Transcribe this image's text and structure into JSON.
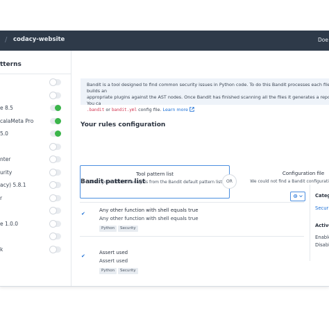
{
  "topbar": {
    "separator": "/",
    "project": "codacy-website",
    "caret": "⌄",
    "user": "Doe"
  },
  "sidebar": {
    "title": "tterns",
    "items": [
      {
        "label": "",
        "on": false
      },
      {
        "label": "",
        "on": false
      },
      {
        "label": "e 8.5",
        "on": true
      },
      {
        "label": "calaMeta Pro",
        "on": true
      },
      {
        "label": "5.0",
        "on": true
      },
      {
        "label": "",
        "on": false
      },
      {
        "label": "nter",
        "on": false
      },
      {
        "label": "urity",
        "on": false
      },
      {
        "label": "acy) 5.8.1",
        "on": false
      },
      {
        "label": "r",
        "on": false
      },
      {
        "label": "",
        "on": false
      },
      {
        "label": "e 1.0.0",
        "on": false
      },
      {
        "label": "",
        "on": false
      },
      {
        "label": "k",
        "on": false
      }
    ]
  },
  "info": {
    "text_1": "Bandit is a tool designed to find common security issues in Python code. To do this Bandit processes each file, builds an",
    "text_2": "appropriate plugins against the AST nodes. Once Bandit has finished scanning all the files it generates a report. You ca",
    "code_1": ".bandit",
    "or_word": "or",
    "code_2": "bandit.yml",
    "text_3": "config file.",
    "link": "Learn more",
    "link_icon": "external-link-icon"
  },
  "rules": {
    "heading": "Your rules configuration",
    "tool": {
      "title": "Tool pattern list",
      "subtitle": "Select your rules for analysis from the Bandit default pattern list"
    },
    "or_label": "OR",
    "config": {
      "title": "Configuration file",
      "subtitle": "We could not find a Bandit configuration file in root"
    }
  },
  "patterns": {
    "heading": "Bandit pattern list",
    "gear_icon": "gear-icon",
    "items": [
      {
        "title": "Any other function with shell equals true",
        "description": "Any other function with shell equals true",
        "tags": [
          "Python",
          "Security"
        ]
      },
      {
        "title": "Assert used",
        "description": "Assert used",
        "tags": [
          "Python",
          "Security"
        ]
      }
    ]
  },
  "right_panel": {
    "category_heading": "Categ",
    "category_value": "Secur",
    "active_heading": "Active",
    "enable": "Enable",
    "disable": "Disabl"
  },
  "colors": {
    "topbar": "#2e3a49",
    "accent": "#1b6fd6",
    "toggle_on": "#3bb54a",
    "info_bg": "#eef3f9"
  }
}
